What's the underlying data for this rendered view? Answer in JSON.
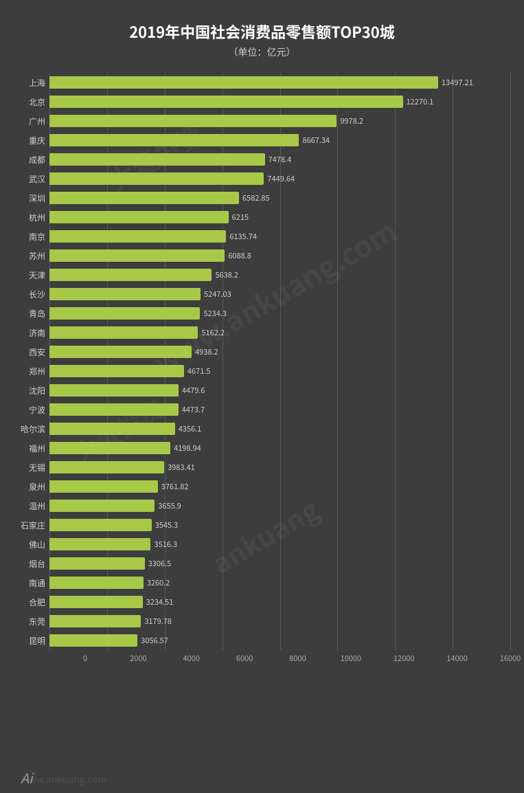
{
  "title": "2019年中国社会消费品零售额TOP30城",
  "subtitle": "（单位：亿元）",
  "maxValue": 16000,
  "xTicks": [
    0,
    2000,
    4000,
    6000,
    8000,
    10000,
    12000,
    14000,
    16000
  ],
  "bars": [
    {
      "city": "上海",
      "value": 13497.21
    },
    {
      "city": "北京",
      "value": 12270.1
    },
    {
      "city": "广州",
      "value": 9978.2
    },
    {
      "city": "重庆",
      "value": 8667.34
    },
    {
      "city": "成都",
      "value": 7478.4
    },
    {
      "city": "武汉",
      "value": 7449.64
    },
    {
      "city": "深圳",
      "value": 6582.85
    },
    {
      "city": "杭州",
      "value": 6215
    },
    {
      "city": "南京",
      "value": 6135.74
    },
    {
      "city": "苏州",
      "value": 6088.8
    },
    {
      "city": "天津",
      "value": 5638.2
    },
    {
      "city": "长沙",
      "value": 5247.03
    },
    {
      "city": "青岛",
      "value": 5234.3
    },
    {
      "city": "济南",
      "value": 5162.2
    },
    {
      "city": "西安",
      "value": 4938.2
    },
    {
      "city": "郑州",
      "value": 4671.5
    },
    {
      "city": "沈阳",
      "value": 4479.6
    },
    {
      "city": "宁波",
      "value": 4473.7
    },
    {
      "city": "哈尔滨",
      "value": 4356.1
    },
    {
      "city": "福州",
      "value": 4198.94
    },
    {
      "city": "无锡",
      "value": 3983.41
    },
    {
      "city": "泉州",
      "value": 3761.82
    },
    {
      "city": "温州",
      "value": 3655.9
    },
    {
      "city": "石家庄",
      "value": 3545.3
    },
    {
      "city": "佛山",
      "value": 3516.3
    },
    {
      "city": "烟台",
      "value": 3306.5
    },
    {
      "city": "南通",
      "value": 3260.2
    },
    {
      "city": "合肥",
      "value": 3234.51
    },
    {
      "city": "东莞",
      "value": 3179.78
    },
    {
      "city": "昆明",
      "value": 3056.57
    }
  ],
  "footer": "www.ankuang.com",
  "ai_label": "Ai"
}
